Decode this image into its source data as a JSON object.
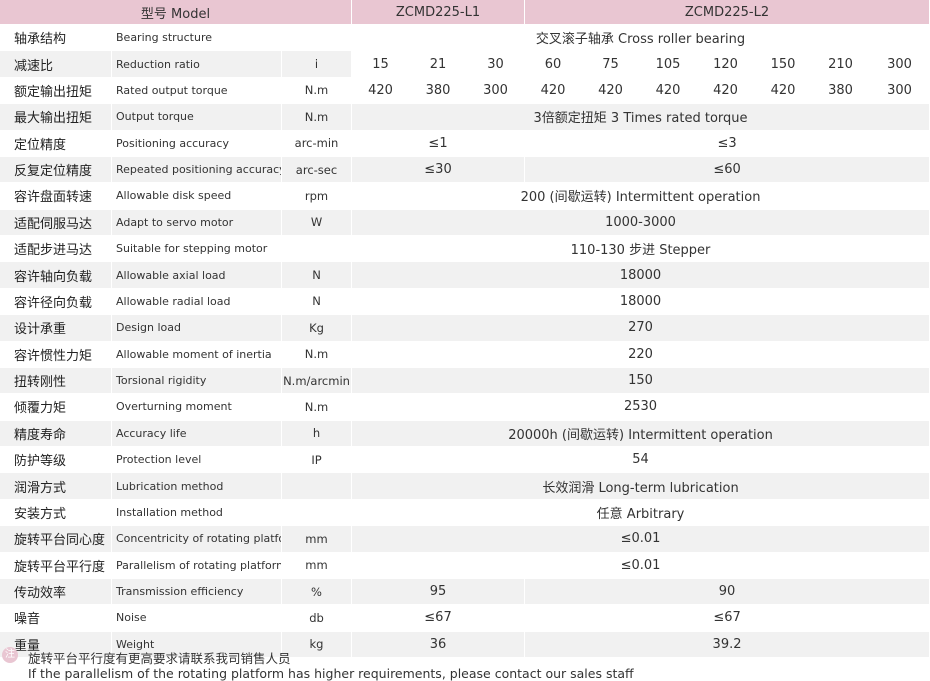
{
  "header": {
    "model_label": "型号 Model",
    "model_l1": "ZCMD225-L1",
    "model_l2": "ZCMD225-L2"
  },
  "rows": {
    "bearing": {
      "cn": "轴承结构",
      "en": "Bearing structure",
      "unit": "",
      "value": "交叉滚子轴承 Cross roller bearing"
    },
    "ratio": {
      "cn": "减速比",
      "en": "Reduction ratio",
      "unit": "i",
      "values": [
        "15",
        "21",
        "30",
        "60",
        "75",
        "105",
        "120",
        "150",
        "210",
        "300"
      ]
    },
    "rated": {
      "cn": "额定输出扭矩",
      "en": "Rated output torque",
      "unit": "N.m",
      "values": [
        "420",
        "380",
        "300",
        "420",
        "420",
        "420",
        "420",
        "420",
        "380",
        "300"
      ]
    },
    "maxout": {
      "cn": "最大输出扭矩",
      "en": "Output torque",
      "unit": "N.m",
      "value": "3倍额定扭矩 3 Times rated torque"
    },
    "posacc": {
      "cn": "定位精度",
      "en": "Positioning accuracy",
      "unit": "arc-min",
      "l1": "≤1",
      "l2": "≤3"
    },
    "reppos": {
      "cn": "反复定位精度",
      "en": "Repeated positioning accuracy",
      "unit": "arc-sec",
      "l1": "≤30",
      "l2": "≤60"
    },
    "disk": {
      "cn": "容许盘面转速",
      "en": "Allowable disk speed",
      "unit": "rpm",
      "value": "200 (间歇运转) Intermittent operation"
    },
    "servo": {
      "cn": "适配伺服马达",
      "en": "Adapt to servo motor",
      "unit": "W",
      "value": "1000-3000"
    },
    "stepper": {
      "cn": "适配步进马达",
      "en": "Suitable for stepping motor",
      "unit": "",
      "value": "110-130 步进 Stepper"
    },
    "axial": {
      "cn": "容许轴向负载",
      "en": "Allowable axial load",
      "unit": "N",
      "value": "18000"
    },
    "radial": {
      "cn": "容许径向负载",
      "en": "Allowable radial load",
      "unit": "N",
      "value": "18000"
    },
    "design": {
      "cn": "设计承重",
      "en": "Design load",
      "unit": "Kg",
      "value": "270"
    },
    "inertia": {
      "cn": "容许惯性力矩",
      "en": "Allowable moment of inertia",
      "unit": "N.m",
      "value": "220"
    },
    "torsional": {
      "cn": "扭转刚性",
      "en": "Torsional rigidity",
      "unit": "N.m/arcmin",
      "value": "150"
    },
    "overturn": {
      "cn": "倾覆力矩",
      "en": "Overturning moment",
      "unit": "N.m",
      "value": "2530"
    },
    "life": {
      "cn": "精度寿命",
      "en": "Accuracy life",
      "unit": "h",
      "value": "20000h (间歇运转) Intermittent operation"
    },
    "protect": {
      "cn": "防护等级",
      "en": "Protection level",
      "unit": "IP",
      "value": "54"
    },
    "lube": {
      "cn": "润滑方式",
      "en": "Lubrication method",
      "unit": "",
      "value": "长效润滑 Long-term lubrication"
    },
    "install": {
      "cn": "安装方式",
      "en": "Installation method",
      "unit": "",
      "value": "任意 Arbitrary"
    },
    "concent": {
      "cn": "旋转平台同心度",
      "en": "Concentricity of rotating platform",
      "unit": "mm",
      "value": "≤0.01"
    },
    "parallel": {
      "cn": "旋转平台平行度",
      "en": "Parallelism of rotating platform",
      "unit": "mm",
      "value": "≤0.01"
    },
    "eff": {
      "cn": "传动效率",
      "en": "Transmission efficiency",
      "unit": "%",
      "l1": "95",
      "l2": "90"
    },
    "noise": {
      "cn": "噪音",
      "en": "Noise",
      "unit": "db",
      "l1": "≤67",
      "l2": "≤67"
    },
    "weight": {
      "cn": "重量",
      "en": "Weight",
      "unit": "kg",
      "l1": "36",
      "l2": "39.2"
    }
  },
  "note": {
    "icon": "注",
    "cn": "旋转平台平行度有更高要求请联系我司销售人员",
    "en": "If the parallelism of the rotating platform has higher requirements, please contact our sales staff"
  },
  "colors": {
    "header_bg": "#e9c6d2",
    "alt_row": "#f1f1f1"
  }
}
